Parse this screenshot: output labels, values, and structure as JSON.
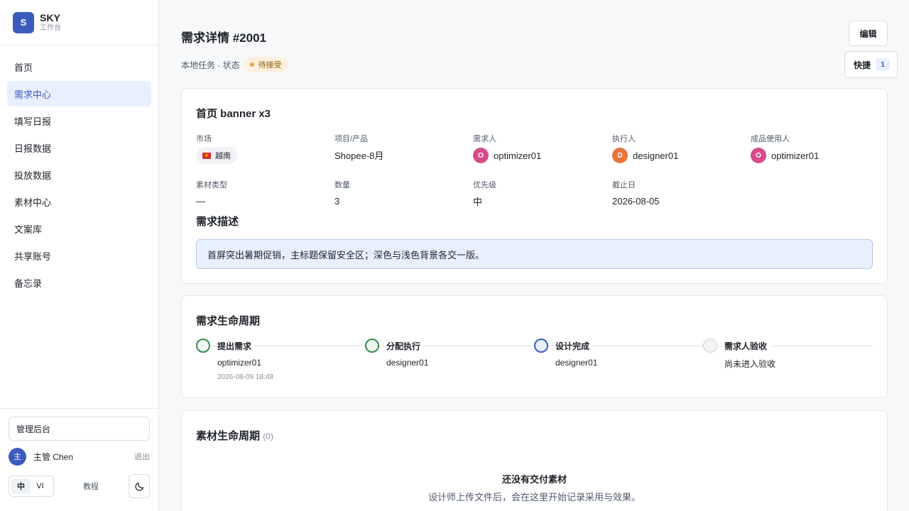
{
  "brand": {
    "logo_letter": "S",
    "name": "SKY",
    "subtitle": "工作台"
  },
  "nav": [
    {
      "label": "首页"
    },
    {
      "label": "需求中心",
      "active": true
    },
    {
      "label": "填写日报"
    },
    {
      "label": "日报数据"
    },
    {
      "label": "投放数据"
    },
    {
      "label": "素材中心"
    },
    {
      "label": "文案库"
    },
    {
      "label": "共享账号"
    },
    {
      "label": "备忘录"
    }
  ],
  "sidebar_bottom": {
    "admin_label": "管理后台",
    "user_avatar": "主",
    "user_name": "主管 Chen",
    "logout": "退出",
    "lang_zh": "中",
    "lang_vi": "VI",
    "tutorial": "教程"
  },
  "header": {
    "title": "需求详情 #2001",
    "source": "本地任务 · 状态",
    "status": "待接受",
    "edit_label": "编辑",
    "quick_label": "快捷",
    "quick_count": "1"
  },
  "detail": {
    "title": "首页 banner x3",
    "market_label": "市场",
    "market_value": "越南",
    "project_label": "项目/产品",
    "project_value": "Shopee-8月",
    "requester_label": "需求人",
    "requester_initial": "O",
    "requester_name": "optimizer01",
    "executor_label": "执行人",
    "executor_initial": "D",
    "executor_name": "designer01",
    "user_label": "成品使用人",
    "user_initial": "O",
    "user_name": "optimizer01",
    "material_type_label": "素材类型",
    "material_type_value": "—",
    "quantity_label": "数量",
    "quantity_value": "3",
    "priority_label": "优先级",
    "priority_value": "中",
    "deadline_label": "截止日",
    "deadline_value": "2026-08-05",
    "desc_title": "需求描述",
    "desc_text": "首屏突出暑期促销，主标题保留安全区；深色与浅色背景各交一版。"
  },
  "lifecycle": {
    "title": "需求生命周期",
    "steps": [
      {
        "title": "提出需求",
        "person": "optimizer01",
        "time": "2026-08-09 18:48",
        "state": "done"
      },
      {
        "title": "分配执行",
        "person": "designer01",
        "time": "",
        "state": "done"
      },
      {
        "title": "设计完成",
        "person": "designer01",
        "time": "",
        "state": "current"
      },
      {
        "title": "需求人验收",
        "person": "尚未进入验收",
        "time": "",
        "state": "pending"
      }
    ]
  },
  "materials": {
    "title": "素材生命周期",
    "count": "(0)",
    "empty_title": "还没有交付素材",
    "empty_sub": "设计师上传文件后，会在这里开始记录采用与效果。"
  },
  "colors": {
    "accent": "#3b5bbd",
    "status_bg": "#fdf1de",
    "status_dot": "#e8a33d",
    "avatar_optimizer": "#d64b8a",
    "avatar_designer": "#e8743b",
    "step_done": "#3b8a4f",
    "step_current": "#3b5bbd"
  }
}
